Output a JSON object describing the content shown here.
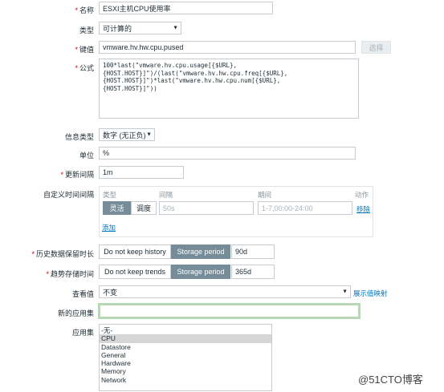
{
  "labels": {
    "name": "名称",
    "type": "类型",
    "key": "键值",
    "formula": "公式",
    "info_type": "信息类型",
    "unit": "单位",
    "update_interval": "更新间隔",
    "custom_intervals": "自定义时间间隔",
    "history": "历史数据保留时长",
    "trends": "趋势存储时间",
    "show_value": "查看值",
    "new_app": "新的应用集",
    "apps": "应用集"
  },
  "fields": {
    "name_value": "ESXI主机CPU使用率",
    "type_value": "可计算的",
    "key_value": "vmware.hv.hw.cpu.pused",
    "select_button": "选择",
    "formula_value": "100*last(\"vmware.hv.cpu.usage[{$URL},\n{HOST.HOST}]\")/(last(\"vmware.hv.hw.cpu.freq[{$URL},\n{HOST.HOST}]\")*last(\"vmware.hv.hw.cpu.num[{$URL},\n{HOST.HOST}]\"))",
    "info_type_value": "数字 (无正负)",
    "unit_value": "%",
    "update_interval_value": "1m",
    "new_app_value": "",
    "show_value_value": "不变",
    "show_value_link": "展示值映射"
  },
  "custom_intervals": {
    "col_type": "类型",
    "col_interval": "间隔",
    "col_period": "期间",
    "col_action": "动作",
    "flexible": "灵活",
    "scheduling": "调度",
    "interval_placeholder": "50s",
    "period_placeholder": "1-7,00:00-24:00",
    "remove": "移除",
    "add": "添加"
  },
  "history": {
    "do_not_keep": "Do not keep history",
    "storage_period": "Storage period",
    "value": "90d"
  },
  "trends": {
    "do_not_keep": "Do not keep trends",
    "storage_period": "Storage period",
    "value": "365d"
  },
  "applications": [
    "-无-",
    "CPU",
    "Datastore",
    "General",
    "Hardware",
    "Memory",
    "Network"
  ],
  "watermark": "@51CTO博客",
  "colors": {
    "required": "#dc0000",
    "active_toggle": "#768d99",
    "link": "#0275b8",
    "focus_border": "#b7d7b7"
  }
}
